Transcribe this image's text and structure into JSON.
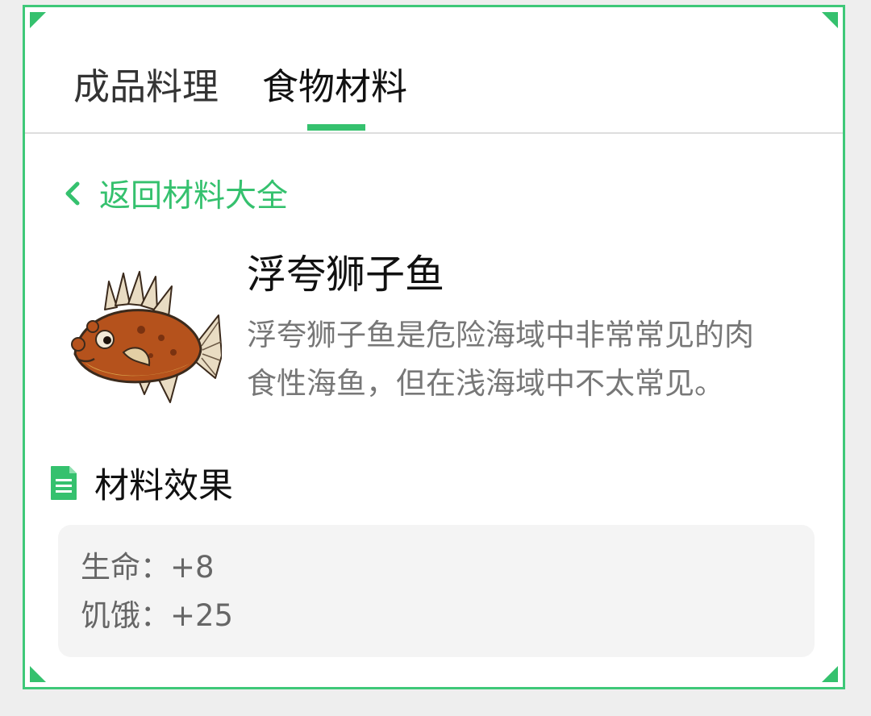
{
  "tabs": [
    {
      "label": "成品料理",
      "active": false
    },
    {
      "label": "食物材料",
      "active": true
    }
  ],
  "back_link": {
    "label": "返回材料大全",
    "icon": "chevron-left-icon"
  },
  "item": {
    "icon": "lionfish-image",
    "name": "浮夸狮子鱼",
    "description": "浮夸狮子鱼是危险海域中非常常见的肉\n食性海鱼，但在浅海域中不太常见。"
  },
  "effects_section": {
    "icon": "document-icon",
    "title": "材料效果",
    "lines": [
      {
        "text": "生命：+8"
      },
      {
        "text": "饥饿：+25"
      }
    ]
  },
  "colors": {
    "accent": "#35c16e",
    "border": "#3ec878",
    "box_bg": "#f4f4f4",
    "desc_text": "#777777"
  }
}
